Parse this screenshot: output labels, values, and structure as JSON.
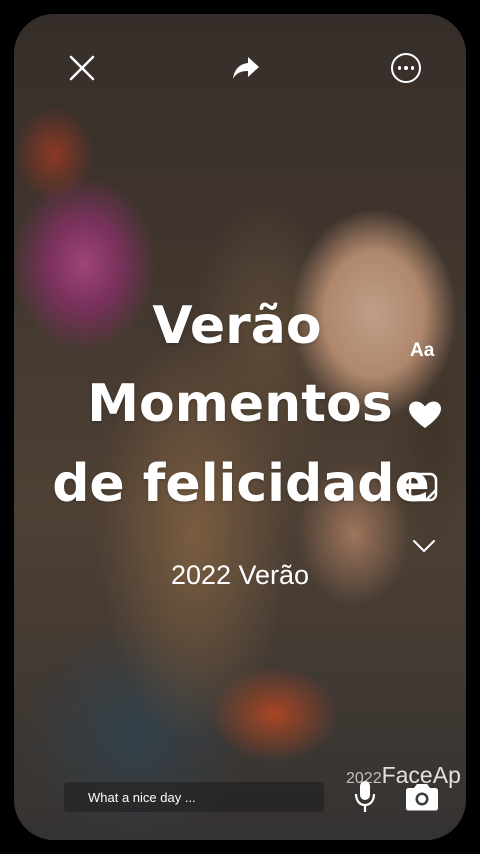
{
  "headline": {
    "line1": "Verão",
    "line2": "Momentos",
    "line3": "de felicidade"
  },
  "subtitle": "2022 Verão",
  "tools": {
    "text_label": "Aa"
  },
  "comment": {
    "placeholder": "What a nice day ..."
  },
  "watermark": {
    "year": "2022",
    "brand": "FaceAp"
  },
  "icons": {
    "close": "close-icon",
    "share": "share-icon",
    "more": "more-icon",
    "heart": "heart-icon",
    "sticker": "sticker-icon",
    "chevron": "chevron-down-icon",
    "mic": "microphone-icon",
    "camera": "camera-icon"
  },
  "colors": {
    "text": "#ffffff",
    "background": "#000000"
  }
}
